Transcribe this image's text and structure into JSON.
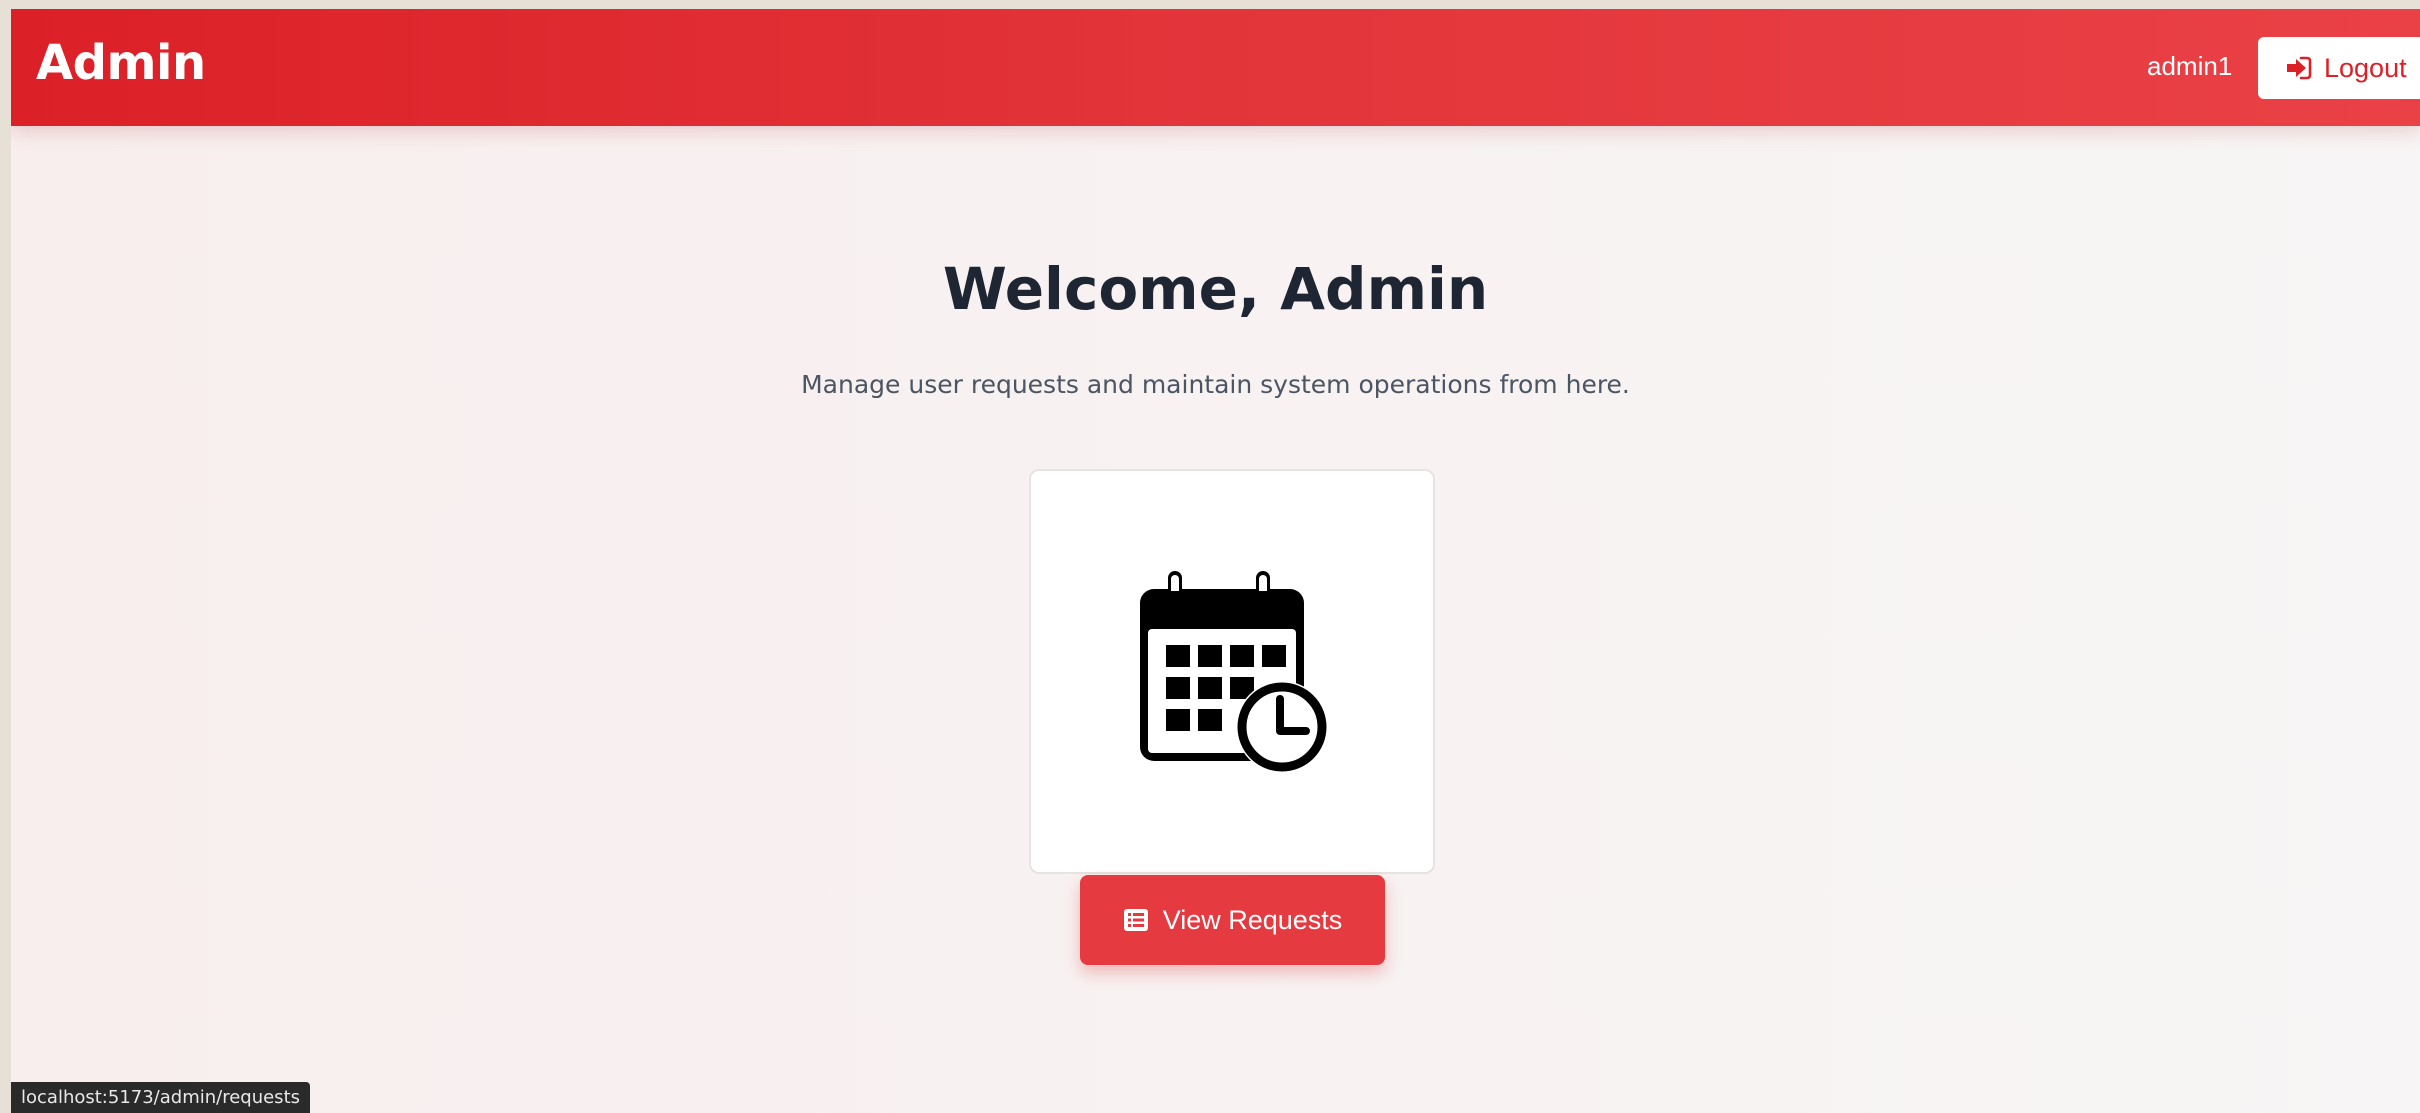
{
  "navbar": {
    "brand": "Admin",
    "username": "admin1",
    "logout_label": "Logout",
    "logout_icon": "sign-in-icon"
  },
  "main": {
    "title": "Welcome, Admin",
    "subtitle": "Manage user requests and maintain system operations from here.",
    "card_icon": "calendar-clock-icon",
    "view_requests_label": "View Requests",
    "view_requests_icon": "list-icon"
  },
  "status_bar": {
    "url": "localhost:5173/admin/requests"
  },
  "colors": {
    "brand_red": "#dc2027",
    "button_red": "#e53a40",
    "heading": "#1e2634",
    "text_muted": "#4b5563"
  }
}
